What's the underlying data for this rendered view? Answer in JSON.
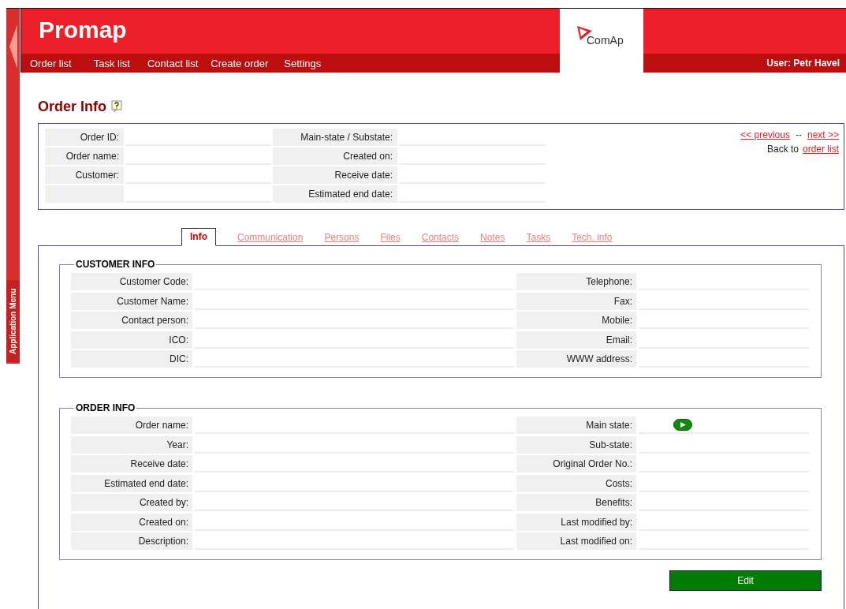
{
  "side_menu": {
    "label": "Application Menu"
  },
  "header": {
    "app_name": "Promap",
    "logo_text": "ComAp",
    "user": "User: Petr Havel"
  },
  "nav": [
    "Order list",
    "Task list",
    "Contact list",
    "Create order",
    "Settings"
  ],
  "page_title": "Order Info",
  "summary": {
    "left": [
      {
        "label": "Order ID:"
      },
      {
        "label": "Order name:"
      },
      {
        "label": "Customer:"
      }
    ],
    "right": [
      {
        "label": "Main-state / Substate:"
      },
      {
        "label": "Created on:"
      },
      {
        "label": "Receive date:"
      },
      {
        "label": "Estimated end date:"
      }
    ],
    "previous": "<< previous",
    "separator": "--",
    "next": "next >>",
    "back_text": "Back to",
    "back_link": "order list"
  },
  "tabs": [
    {
      "label": "Info",
      "selected": true
    },
    {
      "label": "Communication",
      "selected": false
    },
    {
      "label": "Persons",
      "selected": false
    },
    {
      "label": "Files",
      "selected": false
    },
    {
      "label": "Contacts",
      "selected": false
    },
    {
      "label": "Notes",
      "selected": false
    },
    {
      "label": "Tasks",
      "selected": false
    },
    {
      "label": "Tech. info",
      "selected": false
    }
  ],
  "sections": [
    {
      "title": "CUSTOMER INFO",
      "left": [
        {
          "label": "Customer Code:"
        },
        {
          "label": "Customer Name:"
        },
        {
          "label": "Contact person:"
        },
        {
          "label": "ICO:"
        },
        {
          "label": "DIC:"
        }
      ],
      "right": [
        {
          "label": "Telephone:",
          "kind": "text"
        },
        {
          "label": "Fax:",
          "kind": "text"
        },
        {
          "label": "Mobile:",
          "kind": "text"
        },
        {
          "label": "Email:",
          "kind": "text"
        },
        {
          "label": "WWW address:",
          "kind": "text"
        }
      ]
    },
    {
      "title": "ORDER INFO",
      "left": [
        {
          "label": "Order name:"
        },
        {
          "label": "Year:"
        },
        {
          "label": "Receive date:"
        },
        {
          "label": "Estimated end date:"
        },
        {
          "label": "Created by:"
        },
        {
          "label": "Created on:"
        },
        {
          "label": "Description:"
        }
      ],
      "right": [
        {
          "label": "Main state:",
          "kind": "state"
        },
        {
          "label": "Sub-state:",
          "kind": "text"
        },
        {
          "label": "Original Order No.:",
          "kind": "text"
        },
        {
          "label": "Costs:",
          "kind": "text"
        },
        {
          "label": "Benefits:",
          "kind": "text"
        },
        {
          "label": "Last modified by:",
          "kind": "text"
        },
        {
          "label": "Last modified on:",
          "kind": "text"
        }
      ]
    }
  ],
  "edit_button": "Edit"
}
